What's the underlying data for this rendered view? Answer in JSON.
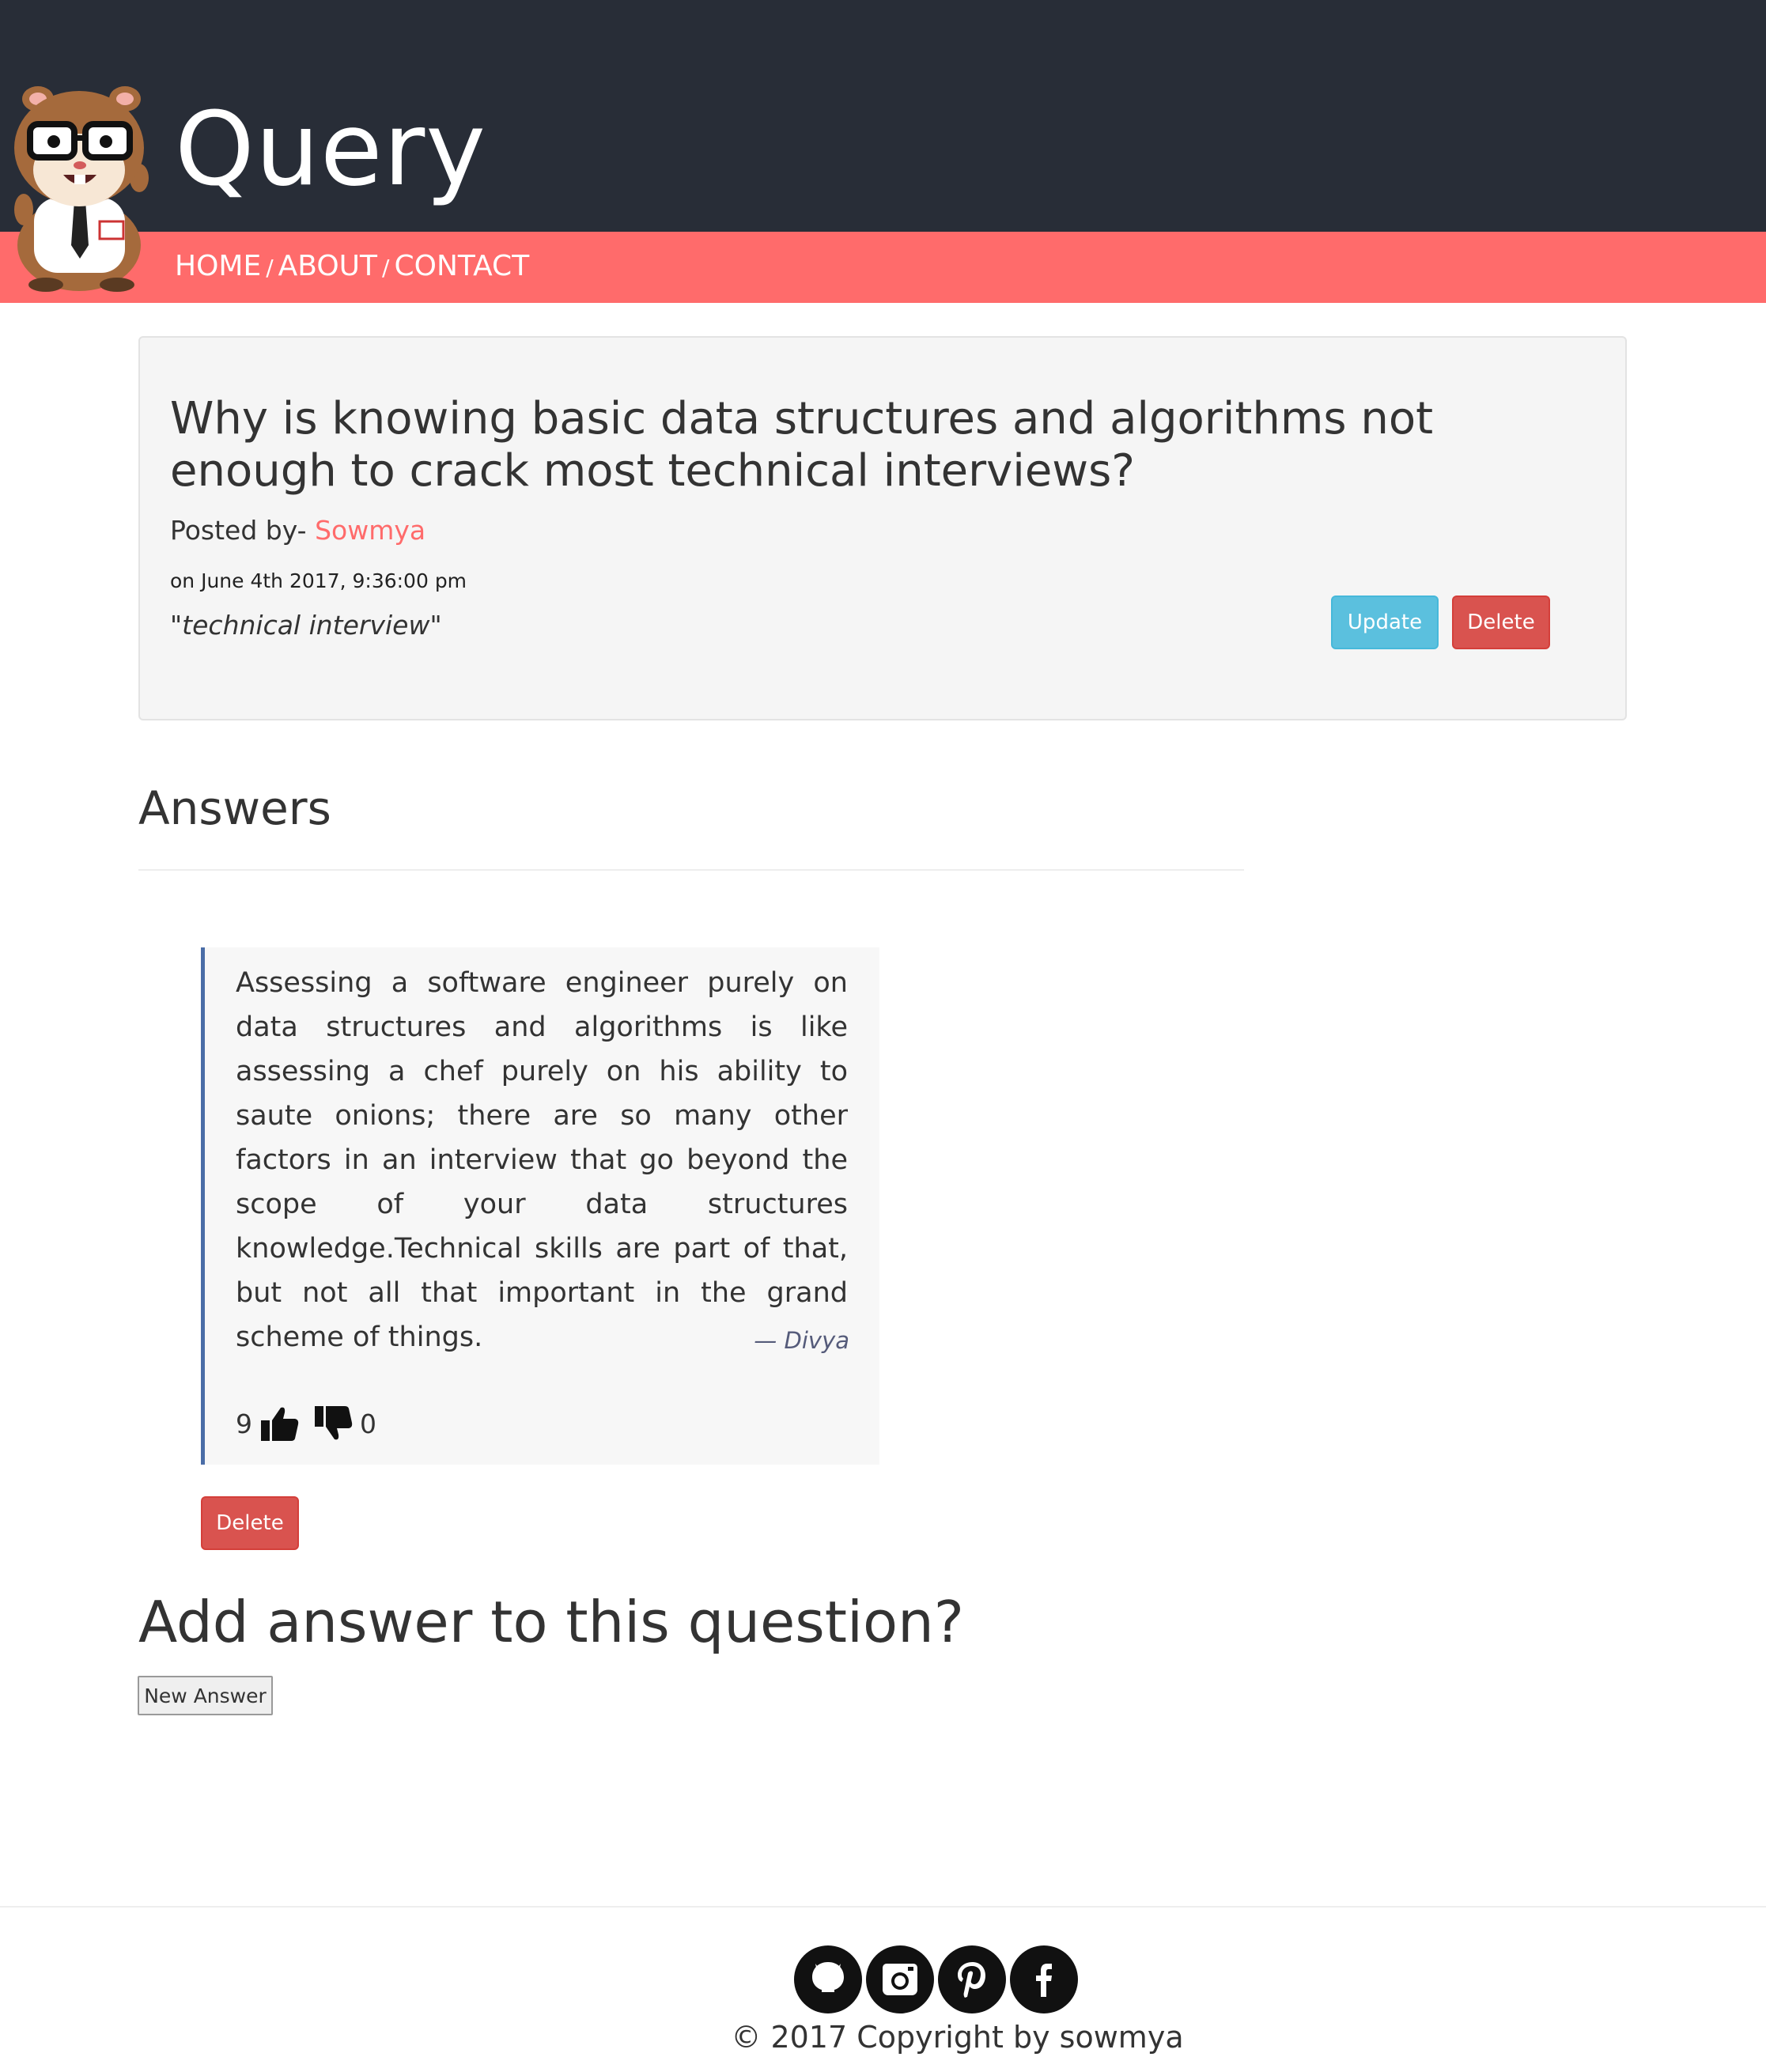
{
  "header": {
    "brand": "Query",
    "nav": {
      "home": "HOME",
      "about": "ABOUT",
      "contact": "CONTACT",
      "separator": "/"
    },
    "mascot_icon": "hamster-mascot-icon"
  },
  "question": {
    "title": "Why is knowing basic data structures and algorithms not enough to crack most technical interviews?",
    "posted_by_label": "Posted by-",
    "author": "Sowmya",
    "posted_on": "on June 4th 2017, 9:36:00 pm",
    "tags": "\"technical interview\"",
    "update_label": "Update",
    "delete_label": "Delete"
  },
  "answers": {
    "heading": "Answers",
    "items": [
      {
        "text": "Assessing a software engineer purely on data structures and algorithms is like assessing a chef purely on his ability to saute onions; there are so many other factors in an interview that go beyond the scope of your data structures knowledge.Technical skills are part of that, but not all that important in the grand scheme of things.",
        "author": "— Divya",
        "upvotes": "9",
        "downvotes": "0",
        "delete_label": "Delete"
      }
    ]
  },
  "add_answer": {
    "heading": "Add answer to this question?",
    "button_label": "New Answer"
  },
  "footer": {
    "social_icons": [
      "github-icon",
      "instagram-icon",
      "pinterest-icon",
      "facebook-icon"
    ],
    "copyright": "© 2017 Copyright by sowmya"
  },
  "colors": {
    "header_bg": "#282d37",
    "nav_bg": "#ff6b6b",
    "accent": "#ff6b6b",
    "update": "#5bc0de",
    "delete": "#d9534f",
    "quote_border": "#4a6da7"
  }
}
